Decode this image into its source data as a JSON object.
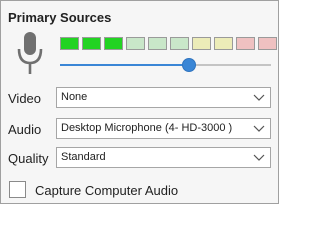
{
  "section": {
    "title": "Primary Sources"
  },
  "meter": {
    "segments": [
      {
        "lit": true,
        "color": "#22d322"
      },
      {
        "lit": true,
        "color": "#22d322"
      },
      {
        "lit": true,
        "color": "#22d322"
      },
      {
        "lit": false,
        "color": "#c9e7c9"
      },
      {
        "lit": false,
        "color": "#c9e7c9"
      },
      {
        "lit": false,
        "color": "#c9e7c9"
      },
      {
        "lit": false,
        "color": "#ececb8"
      },
      {
        "lit": false,
        "color": "#ececb8"
      },
      {
        "lit": false,
        "color": "#efc1c1"
      },
      {
        "lit": false,
        "color": "#efc1c1"
      }
    ]
  },
  "volume": {
    "level_percent": 61,
    "accent_color": "#3a86d6"
  },
  "video": {
    "label": "Video",
    "value": "None"
  },
  "audio": {
    "label": "Audio",
    "value": "Desktop Microphone (4- HD-3000 )"
  },
  "quality": {
    "label": "Quality",
    "value": "Standard"
  },
  "capture_audio": {
    "label": "Capture Computer Audio",
    "checked": false
  },
  "icons": {
    "microphone": "microphone-icon",
    "dropdown": "chevron-down-icon"
  }
}
